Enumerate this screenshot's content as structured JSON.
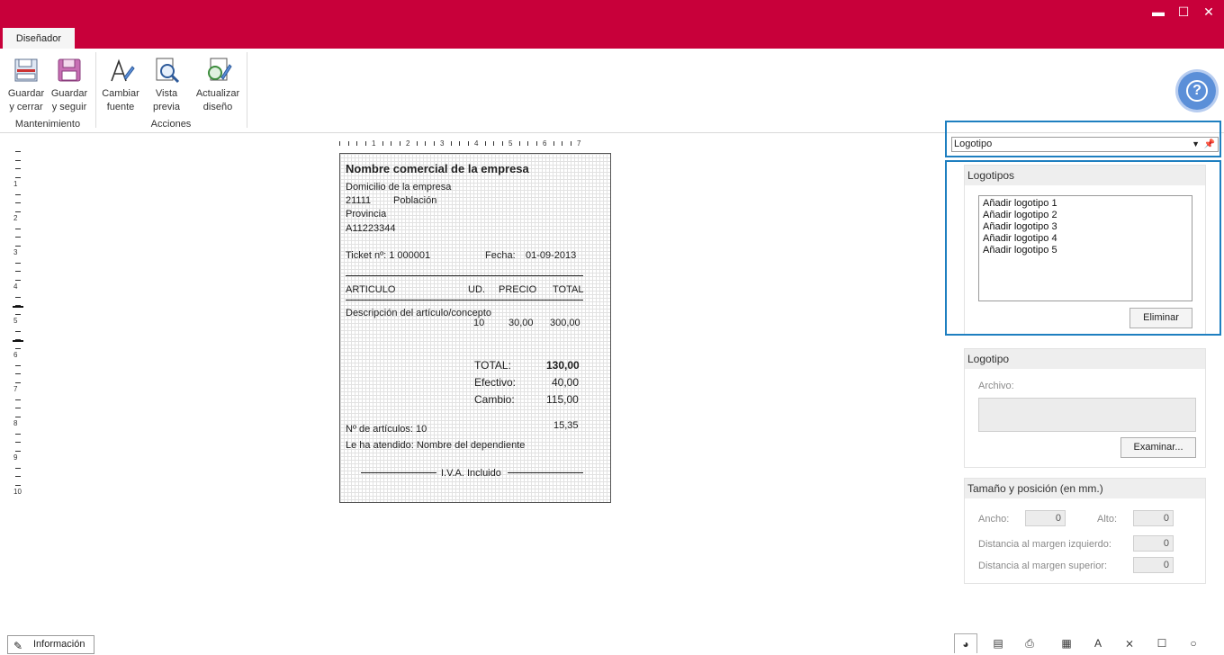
{
  "window": {
    "minimize_label": "▬",
    "maximize_label": "☐",
    "close_label": "✕"
  },
  "ribbon": {
    "tab_label": "Diseñador",
    "groups": [
      {
        "label": "Mantenimiento"
      },
      {
        "label": "Acciones"
      }
    ],
    "buttons": [
      {
        "line1": "Guardar",
        "line2": "y cerrar",
        "icon": "save-close-icon"
      },
      {
        "line1": "Guardar",
        "line2": "y seguir",
        "icon": "floppy-disk-icon"
      },
      {
        "line1": "Cambiar",
        "line2": "fuente",
        "icon": "font-pen-icon"
      },
      {
        "line1": "Vista",
        "line2": "previa",
        "icon": "preview-magnifier-icon"
      },
      {
        "line1": "Actualizar",
        "line2": "diseño",
        "icon": "refresh-design-icon"
      }
    ],
    "help_label": "?"
  },
  "rulers": {
    "horizontal_labels": [
      "1",
      "2",
      "3",
      "4",
      "5",
      "6",
      "7"
    ],
    "vertical_labels": [
      "1",
      "2",
      "3",
      "4",
      "5",
      "6",
      "7",
      "8",
      "9",
      "10"
    ]
  },
  "ticket": {
    "company_name": "Nombre  comercial de la empresa",
    "address": "Domicilio de la empresa",
    "postal_code": "21111",
    "town": "Población",
    "province": "Provincia",
    "tax_id": "A11223344",
    "ticket_label": "Ticket nº:  1  000001",
    "date_label": "Fecha:",
    "date_value": "01-09-2013",
    "col_article": "ARTICULO",
    "col_units": "UD.",
    "col_price": "PRECIO",
    "col_total": "TOTAL",
    "item_description": "Descripción del artículo/concepto",
    "item_units": "10",
    "item_price": "30,00",
    "item_total": "300,00",
    "total_label": "TOTAL:",
    "total_value": "130,00",
    "cash_label": "Efectivo:",
    "cash_value": "40,00",
    "change_label": "Cambio:",
    "change_value": "115,00",
    "extra_value": "15,35",
    "articles_count": "Nº de artículos:  10",
    "served_by": "Le ha atendido:  Nombre del dependiente",
    "vat_included": "I.V.A. Incluido"
  },
  "right_panel": {
    "selector_value": "Logotipo",
    "logos_header": "Logotipos",
    "logos": [
      "Añadir logotipo 1",
      "Añadir logotipo 2",
      "Añadir logotipo 3",
      "Añadir logotipo 4",
      "Añadir logotipo 5"
    ],
    "delete_button": "Eliminar",
    "logo_header": "Logotipo",
    "file_label": "Archivo:",
    "browse_button": "Examinar...",
    "size_header": "Tamaño y posición (en mm.)",
    "width_label": "Ancho:",
    "width_value": "0",
    "height_label": "Alto:",
    "height_value": "0",
    "left_margin_label": "Distancia al margen izquierdo:",
    "left_margin_value": "0",
    "top_margin_label": "Distancia al margen superior:",
    "top_margin_value": "0"
  },
  "status_bar": {
    "info_button": "Información"
  },
  "bottom_tabs": [
    {
      "icon": "logo-tab-icon",
      "glyph": "◕"
    },
    {
      "icon": "header-tab-icon",
      "glyph": "▤"
    },
    {
      "icon": "printer-tab-icon",
      "glyph": "⎙"
    },
    {
      "icon": "qr-batuz-tab-icon",
      "glyph": "▦"
    },
    {
      "icon": "text-tab-icon",
      "glyph": "A"
    },
    {
      "icon": "line-tab-icon",
      "glyph": "⨯"
    },
    {
      "icon": "rectangle-tab-icon",
      "glyph": "☐"
    },
    {
      "icon": "ellipse-tab-icon",
      "glyph": "○"
    }
  ],
  "colors": {
    "titlebar": "#c8003a",
    "highlight": "#1e7fc0",
    "help": "#5b8fd8"
  }
}
